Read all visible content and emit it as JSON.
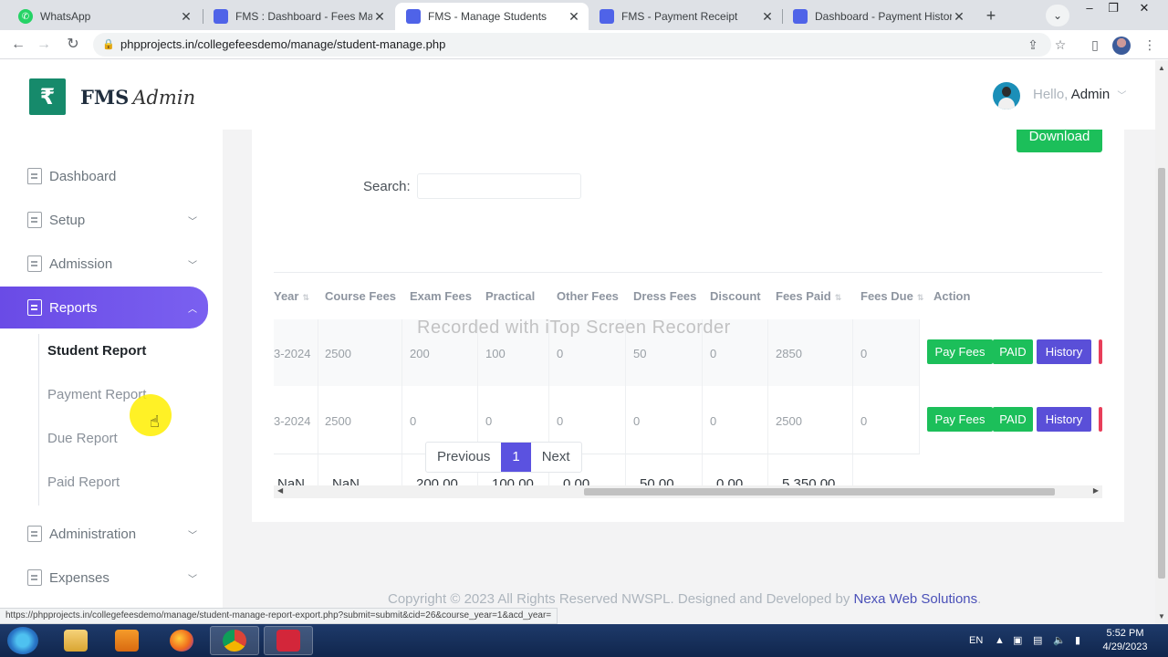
{
  "browser": {
    "tabs": [
      {
        "title": "WhatsApp",
        "favicon": "whatsapp-icon",
        "active": false
      },
      {
        "title": "FMS : Dashboard - Fees Mana",
        "favicon": "fms-icon",
        "active": false
      },
      {
        "title": "FMS - Manage Students",
        "favicon": "fms-icon",
        "active": true
      },
      {
        "title": "FMS - Payment Receipt",
        "favicon": "fms-icon",
        "active": false
      },
      {
        "title": "Dashboard - Payment History",
        "favicon": "fms-icon",
        "active": false
      }
    ],
    "close_glyph": "✕",
    "new_tab_glyph": "+",
    "url": "phpprojects.in/collegefeesdemo/manage/student-manage.php",
    "status_url": "https://phpprojects.in/collegefeesdemo/manage/student-manage-report-export.php?submit=submit&cid=26&course_year=1&acd_year="
  },
  "sidebar": {
    "logo_mark": "₹",
    "logo_text_bold": "FMS",
    "logo_text_italic": "Admin",
    "menu": [
      {
        "label": "Dashboard",
        "icon": "home-icon"
      },
      {
        "label": "Setup",
        "icon": "document-icon"
      },
      {
        "label": "Admission",
        "icon": "document-icon"
      },
      {
        "label": "Reports",
        "icon": "document-icon"
      },
      {
        "label": "Administration",
        "icon": "document-icon"
      },
      {
        "label": "Expenses",
        "icon": "document-icon"
      }
    ],
    "reports_submenu": [
      "Student Report",
      "Payment Report",
      "Due Report",
      "Paid Report"
    ]
  },
  "header": {
    "greeting": "Hello,",
    "user": "Admin"
  },
  "content": {
    "download_label": "Download",
    "search_label": "Search:",
    "search_value": "",
    "columns": [
      "Year",
      "Course Fees",
      "Exam Fees",
      "Practical",
      "Other Fees",
      "Dress Fees",
      "Discount",
      "Fees Paid",
      "Fees Due",
      "Action"
    ],
    "rows": [
      {
        "year": "3-2024",
        "course_fees": "2500",
        "exam_fees": "200",
        "practical": "100",
        "other_fees": "0",
        "dress_fees": "50",
        "discount": "0",
        "fees_paid": "2850",
        "fees_due": "0"
      },
      {
        "year": "3-2024",
        "course_fees": "2500",
        "exam_fees": "0",
        "practical": "0",
        "other_fees": "0",
        "dress_fees": "0",
        "discount": "0",
        "fees_paid": "2500",
        "fees_due": "0"
      }
    ],
    "totals": {
      "year": "NaN",
      "course_fees": "NaN",
      "exam_fees": "200.00",
      "practical": "100.00",
      "other_fees": "0.00",
      "dress_fees": "50.00",
      "discount": "0.00",
      "fees_paid": "5,350.00"
    },
    "actions": {
      "pay": "Pay Fees",
      "paid": "PAID",
      "history": "History"
    },
    "pagination": {
      "previous": "Previous",
      "current": "1",
      "next": "Next"
    }
  },
  "footer": {
    "text": "Copyright © 2023 All Rights Reserved NWSPL. Designed and Developed by",
    "link": "Nexa Web Solutions",
    "end": "."
  },
  "watermark": "Recorded with iTop Screen Recorder",
  "taskbar": {
    "language": "EN",
    "time": "5:52 PM",
    "date": "4/29/2023"
  },
  "colors": {
    "accent": "#6a4be6",
    "success": "#1cbf5a",
    "history": "#5a4fd8",
    "brand": "#168a6b"
  }
}
